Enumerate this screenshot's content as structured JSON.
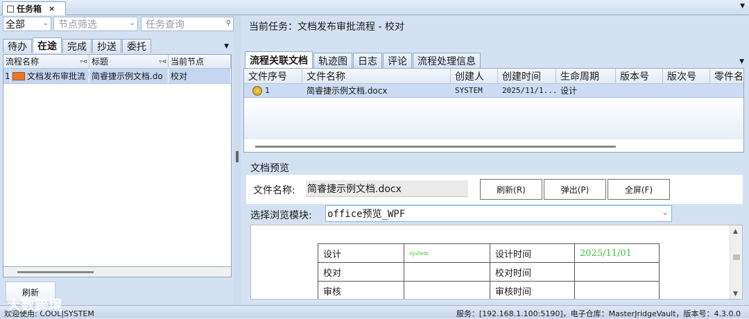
{
  "top_tab": {
    "label": "任务箱",
    "close": "×"
  },
  "filters": {
    "scope": "全部",
    "node_placeholder": "节点筛选",
    "search_placeholder": "任务查询"
  },
  "left_tabs": [
    "待办",
    "在途",
    "完成",
    "抄送",
    "委托"
  ],
  "left_active_tab": "在途",
  "task_grid": {
    "headers": [
      "流程名称",
      "标题",
      "当前节点"
    ],
    "rows": [
      {
        "index": "1",
        "process": "文档发布审批流",
        "title": "简睿捷示例文档.do",
        "node": "校对"
      }
    ]
  },
  "refresh_label": "刷新",
  "current_task": "当前任务：文档发布审批流程 - 校对",
  "right_tabs": [
    "流程关联文档",
    "轨迹图",
    "日志",
    "评论",
    "流程处理信息"
  ],
  "right_active_tab": "流程关联文档",
  "file_grid": {
    "headers": [
      "文件序号",
      "文件名称",
      "创建人",
      "创建时间",
      "生命周期",
      "版本号",
      "版次号",
      "零件名"
    ],
    "rows": [
      {
        "seq": "1",
        "name": "简睿捷示例文档.docx",
        "creator": "SYSTEM",
        "created": "2025/11/1...",
        "lifecycle": "设计",
        "version": "",
        "revision": ""
      }
    ]
  },
  "preview": {
    "title": "文档预览",
    "filename_label": "文件名称:",
    "filename_value": "简睿捷示例文档.docx",
    "buttons": {
      "refresh": "刷新(R)",
      "popup": "弹出(P)",
      "fullscreen": "全屏(F)"
    },
    "module_label": "选择浏览模块:",
    "module_value": "office预览_WPF"
  },
  "doc_table": [
    [
      "设计",
      "system",
      "设计时间",
      "2025/11/01"
    ],
    [
      "校对",
      "",
      "校对时间",
      ""
    ],
    [
      "审核",
      "",
      "审核时间",
      ""
    ]
  ],
  "status": {
    "left": "欢迎使用: COOL|SYSTEM",
    "right": "服务：[192.168.1.100:5190]，电子仓库：MasterJridgeVault，版本号：4.3.0.0"
  },
  "watermark": "大数跨境"
}
